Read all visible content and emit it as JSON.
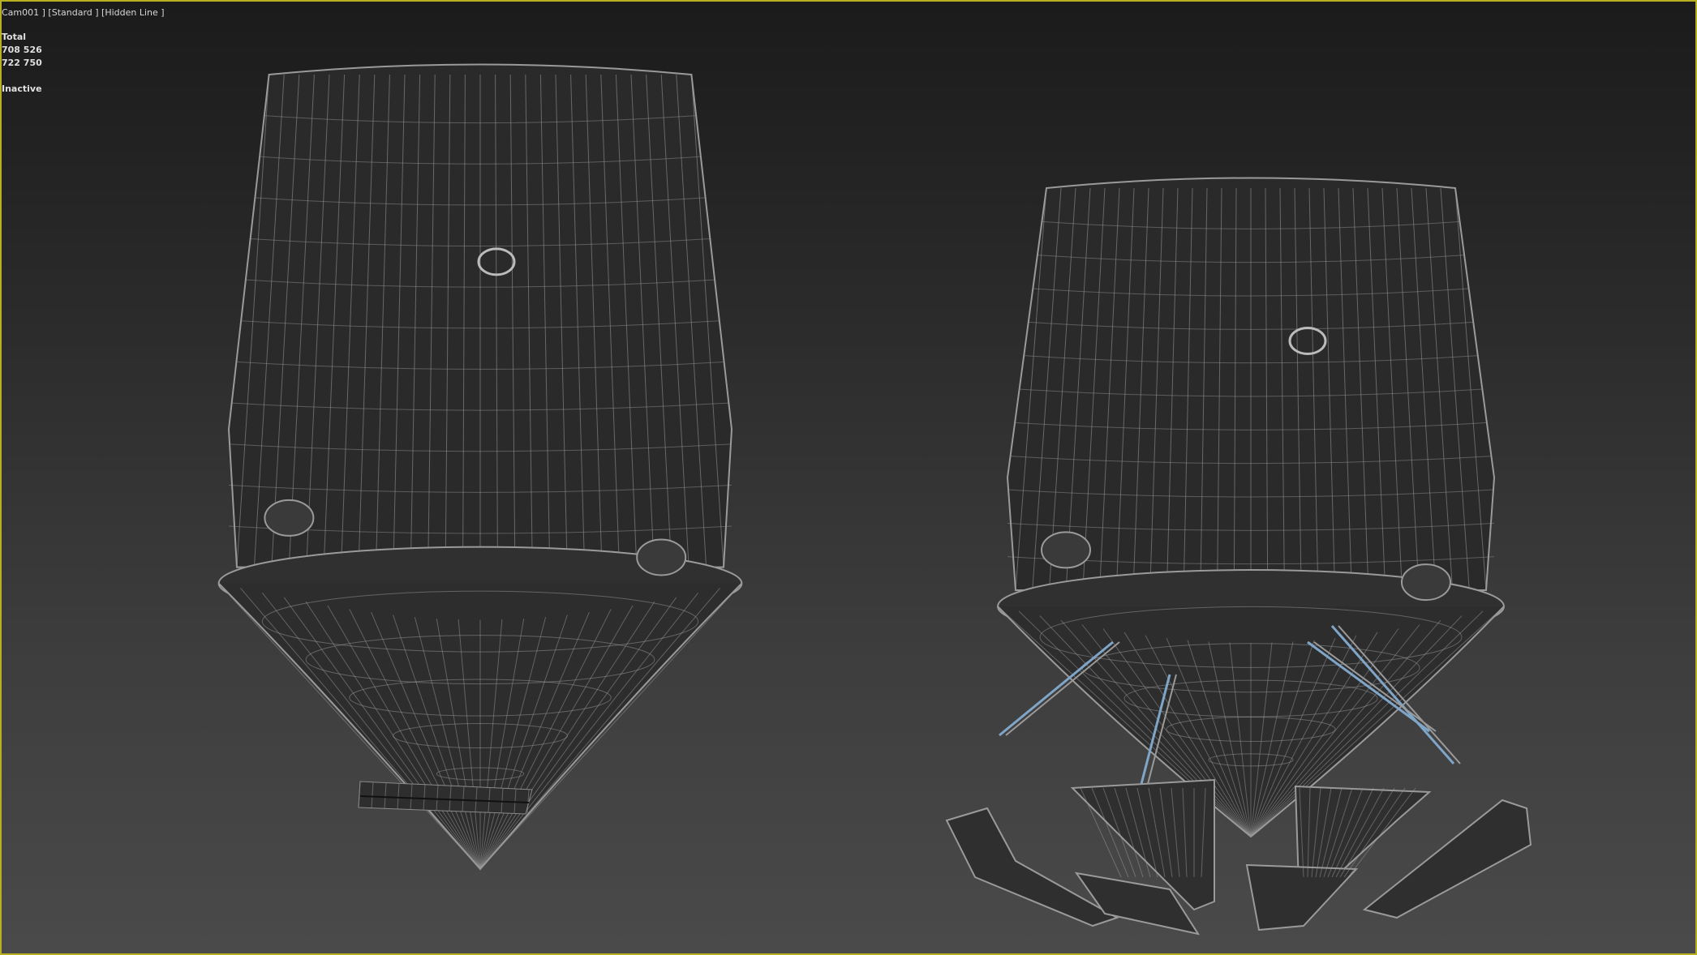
{
  "viewport": {
    "label": "Cam001 ] [Standard ] [Hidden Line ]",
    "stats": {
      "title": "Total",
      "polys": "708 526",
      "verts": "722 750",
      "status": "Inactive"
    },
    "colors": {
      "border": "#b8b020",
      "wire": "#9a9a9a",
      "accent": "#7fa6c8"
    }
  }
}
